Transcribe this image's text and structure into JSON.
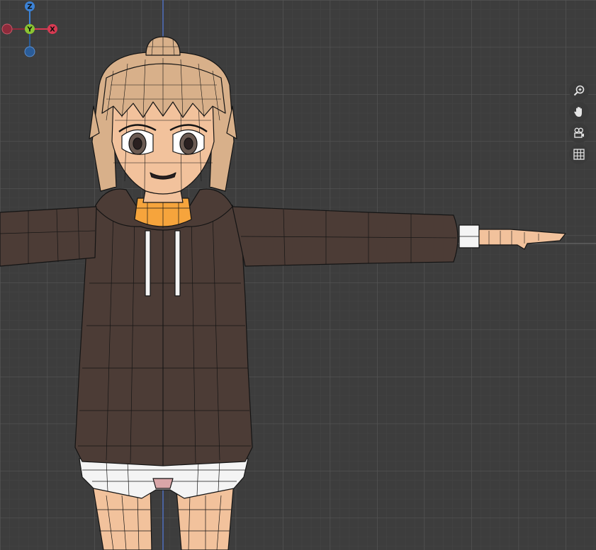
{
  "viewport": {
    "background": "#3d3d3d",
    "grid_minor_color": "#454545",
    "grid_major_color": "#555555",
    "z_axis_line_color": "#4f6fbf",
    "y_axis_line_color": "#6f6f6f"
  },
  "model": {
    "skin_color": "#f2c29c",
    "hair_color": "#d8b08a",
    "hoodie_color": "#4c3c36",
    "turtleneck_color": "#f6a43c",
    "shorts_color": "#f4f4f4",
    "wire_color": "#141414"
  },
  "gizmo": {
    "z_label": "Z",
    "y_label": "Y",
    "x_label": "X",
    "z_color": "#3b82d6",
    "y_color": "#8ac432",
    "x_color": "#d83a52",
    "neg_x_color": "#8e2b3b",
    "neg_z_color": "#2a5c98"
  },
  "nav_buttons": [
    {
      "name": "zoom-icon"
    },
    {
      "name": "hand-pan-icon"
    },
    {
      "name": "camera-icon"
    },
    {
      "name": "grid-icon"
    }
  ]
}
